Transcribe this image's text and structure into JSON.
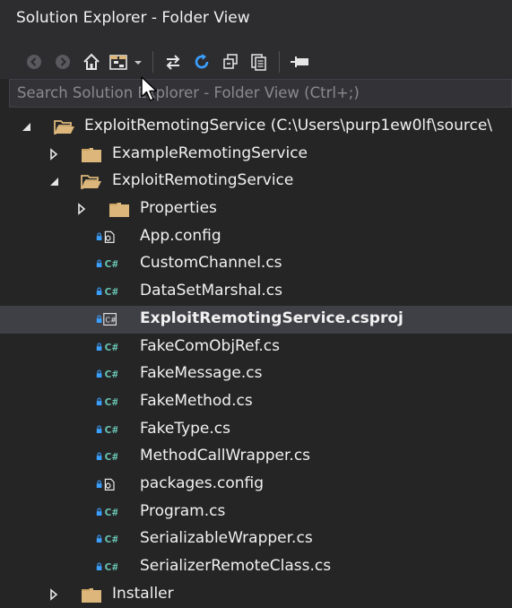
{
  "window": {
    "title": "Solution Explorer - Folder View"
  },
  "toolbar": {
    "buttons": [
      {
        "name": "back-button",
        "icon": "back-arrow-circle-icon"
      },
      {
        "name": "forward-button",
        "icon": "forward-arrow-circle-icon"
      },
      {
        "name": "home-button",
        "icon": "home-icon"
      },
      {
        "name": "switch-views-button",
        "icon": "switch-views-icon"
      },
      {
        "name": "sync-button",
        "icon": "sync-arrows-icon"
      },
      {
        "name": "refresh-button",
        "icon": "refresh-icon"
      },
      {
        "name": "collapse-all-button",
        "icon": "collapse-all-icon"
      },
      {
        "name": "show-all-files-button",
        "icon": "show-all-files-icon"
      },
      {
        "name": "pin-button",
        "icon": "pin-icon"
      }
    ]
  },
  "search": {
    "placeholder": "Search Solution Explorer - Folder View (Ctrl+;)"
  },
  "tree": [
    {
      "label": "ExploitRemotingService (C:\\Users\\purp1ew0lf\\source\\",
      "type": "folder-open",
      "level": 0,
      "expander": "expanded"
    },
    {
      "label": "ExampleRemotingService",
      "type": "folder",
      "level": 1,
      "expander": "collapsed"
    },
    {
      "label": "ExploitRemotingService",
      "type": "folder-open",
      "level": 1,
      "expander": "expanded"
    },
    {
      "label": "Properties",
      "type": "folder",
      "level": 2,
      "expander": "collapsed"
    },
    {
      "label": "App.config",
      "type": "config",
      "level": 2
    },
    {
      "label": "CustomChannel.cs",
      "type": "cs",
      "level": 2
    },
    {
      "label": "DataSetMarshal.cs",
      "type": "cs",
      "level": 2
    },
    {
      "label": "ExploitRemotingService.csproj",
      "type": "csproj",
      "level": 2,
      "selected": true
    },
    {
      "label": "FakeComObjRef.cs",
      "type": "cs",
      "level": 2
    },
    {
      "label": "FakeMessage.cs",
      "type": "cs",
      "level": 2
    },
    {
      "label": "FakeMethod.cs",
      "type": "cs",
      "level": 2
    },
    {
      "label": "FakeType.cs",
      "type": "cs",
      "level": 2
    },
    {
      "label": "MethodCallWrapper.cs",
      "type": "cs",
      "level": 2
    },
    {
      "label": "packages.config",
      "type": "config",
      "level": 2
    },
    {
      "label": "Program.cs",
      "type": "cs",
      "level": 2
    },
    {
      "label": "SerializableWrapper.cs",
      "type": "cs",
      "level": 2
    },
    {
      "label": "SerializerRemoteClass.cs",
      "type": "cs",
      "level": 2
    },
    {
      "label": "Installer",
      "type": "folder",
      "level": 1,
      "expander": "collapsed"
    }
  ],
  "colors": {
    "background": "#252526",
    "toolbar": "#2d2d30",
    "text": "#f1f1f1",
    "folder": "#dcb67a",
    "csharp": "#68c3b1",
    "lock": "#3aa0ff",
    "selection": "#3f3f46"
  }
}
